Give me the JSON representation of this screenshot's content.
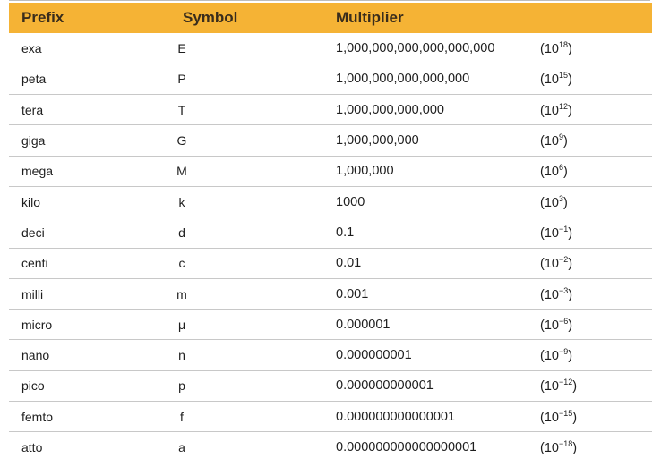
{
  "table": {
    "headers": [
      "Prefix",
      "Symbol",
      "Multiplier"
    ],
    "rows": [
      {
        "prefix": "exa",
        "symbol": "E",
        "multiplier": "1,000,000,000,000,000,000",
        "base": "(10",
        "exp": "18",
        "close": ")"
      },
      {
        "prefix": "peta",
        "symbol": "P",
        "multiplier": "1,000,000,000,000,000",
        "base": "(10",
        "exp": "15",
        "close": ")"
      },
      {
        "prefix": "tera",
        "symbol": "T",
        "multiplier": "1,000,000,000,000",
        "base": "(10",
        "exp": "12",
        "close": ")"
      },
      {
        "prefix": "giga",
        "symbol": "G",
        "multiplier": "1,000,000,000",
        "base": "(10",
        "exp": "9",
        "close": ")"
      },
      {
        "prefix": "mega",
        "symbol": "M",
        "multiplier": "1,000,000",
        "base": "(10",
        "exp": "6",
        "close": ")"
      },
      {
        "prefix": "kilo",
        "symbol": "k",
        "multiplier": "1000",
        "base": "(10",
        "exp": "3",
        "close": ")"
      },
      {
        "prefix": "deci",
        "symbol": "d",
        "multiplier": "0.1",
        "base": "(10",
        "exp": "−1",
        "close": ")"
      },
      {
        "prefix": "centi",
        "symbol": "c",
        "multiplier": "0.01",
        "base": "(10",
        "exp": "−2",
        "close": ")"
      },
      {
        "prefix": "milli",
        "symbol": "m",
        "multiplier": "0.001",
        "base": "(10",
        "exp": "−3",
        "close": ")"
      },
      {
        "prefix": "micro",
        "symbol": "μ",
        "multiplier": "0.000001",
        "base": "(10",
        "exp": "−6",
        "close": ")"
      },
      {
        "prefix": "nano",
        "symbol": "n",
        "multiplier": "0.000000001",
        "base": "(10",
        "exp": "−9",
        "close": ")"
      },
      {
        "prefix": "pico",
        "symbol": "p",
        "multiplier": "0.000000000001",
        "base": "(10",
        "exp": "−12",
        "close": ")"
      },
      {
        "prefix": "femto",
        "symbol": "f",
        "multiplier": "0.000000000000001",
        "base": "(10",
        "exp": "−15",
        "close": ")"
      },
      {
        "prefix": "atto",
        "symbol": "a",
        "multiplier": "0.000000000000000001",
        "base": "(10",
        "exp": "−18",
        "close": ")"
      }
    ]
  },
  "colors": {
    "header_bg": "#f5b335",
    "header_text": "#3a2d1c",
    "row_divider": "#c8c8c8"
  }
}
